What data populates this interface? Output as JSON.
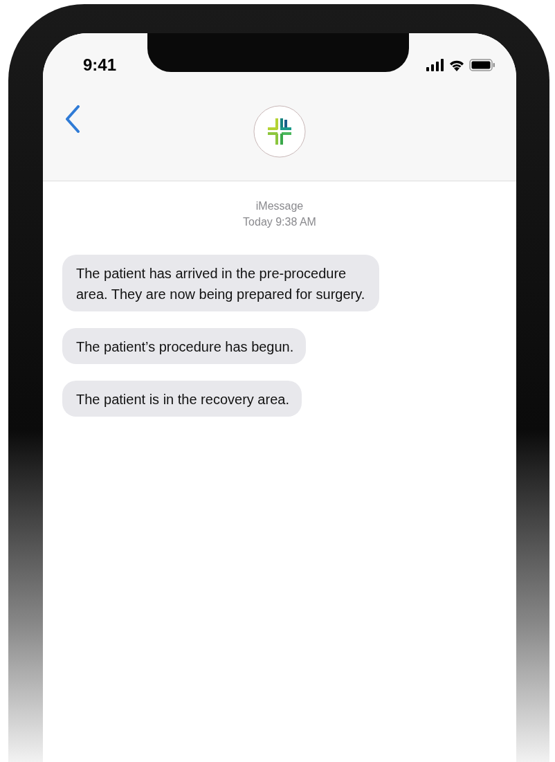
{
  "status_bar": {
    "time": "9:41"
  },
  "conversation": {
    "service": "iMessage",
    "timestamp": "Today 9:38 AM"
  },
  "messages": [
    {
      "text": "The patient has arrived in the pre-procedure area. They are now being prepared for surgery."
    },
    {
      "text": "The patient’s procedure has begun."
    },
    {
      "text": "The patient is in the recovery area."
    }
  ]
}
